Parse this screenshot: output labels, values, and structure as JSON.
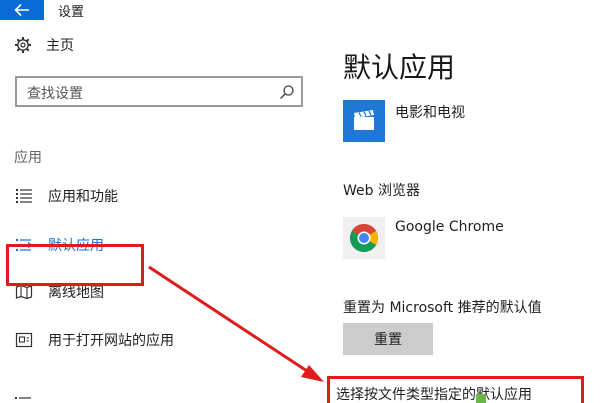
{
  "window": {
    "title": "设置"
  },
  "sidebar": {
    "home_label": "主页",
    "search_placeholder": "查找设置",
    "section_label": "应用",
    "items": [
      {
        "label": "应用和功能",
        "icon": "list-icon"
      },
      {
        "label": "默认应用",
        "icon": "default-apps-icon",
        "active": true
      },
      {
        "label": "离线地图",
        "icon": "offline-map-icon"
      },
      {
        "label": "用于打开网站的应用",
        "icon": "open-website-icon"
      }
    ]
  },
  "main": {
    "heading": "默认应用",
    "video_app": {
      "name": "电影和电视",
      "icon": "movies-tv-icon"
    },
    "web_browser": {
      "heading": "Web 浏览器",
      "name": "Google Chrome",
      "icon": "chrome-icon"
    },
    "reset": {
      "label": "重置为 Microsoft 推荐的默认值",
      "button": "重置"
    },
    "filetype_link": "选择按文件类型指定的默认应用"
  },
  "colors": {
    "accent": "#0a6ad6",
    "active_text": "#1a6fd8",
    "annotation_red": "#e01b1b",
    "button_gray": "#cccccc"
  }
}
